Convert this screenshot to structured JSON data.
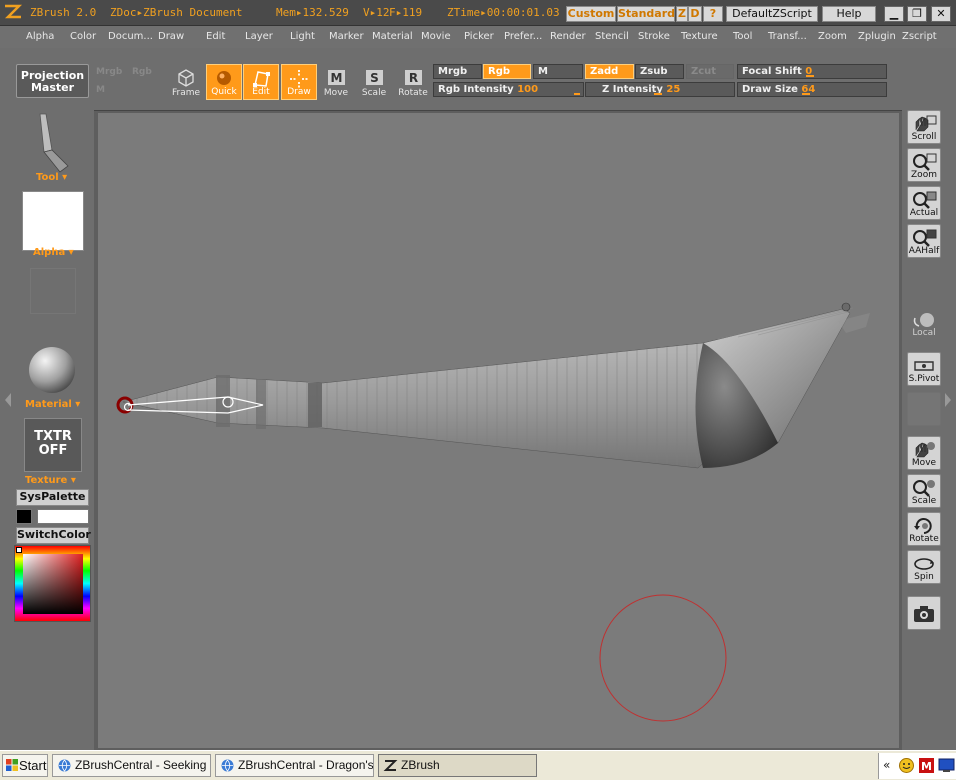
{
  "titlebar": {
    "app": "ZBrush 2.0",
    "doc": "ZDoc▸ZBrush Document",
    "mem": "Mem▸132.529",
    "vcount": "V▸12",
    "fcount": "F▸119",
    "ztime": "ZTime▸00:00:01.03",
    "custom": "Custom",
    "standard": "Standard",
    "z": "Z",
    "d": "D",
    "help_q": "?",
    "default_script": "DefaultZScript",
    "help": "Help",
    "win_min": "▁",
    "win_restore": "❐",
    "win_close": "✕"
  },
  "menu": [
    "Alpha",
    "Color",
    "Docum...",
    "Draw",
    "Edit",
    "Layer",
    "Light",
    "Marker",
    "Material",
    "Movie",
    "Picker",
    "Prefer...",
    "Render",
    "Stencil",
    "Stroke",
    "Texture",
    "Tool",
    "Transf...",
    "Zoom",
    "Zplugin",
    "Zscript"
  ],
  "shelf": {
    "projection_master": [
      "Projection",
      "Master"
    ],
    "modes": [
      {
        "label": "Frame",
        "icon": "frame-cube-icon",
        "active": false
      },
      {
        "label": "Quick",
        "icon": "quick-sphere-icon",
        "active": true
      },
      {
        "label": "Edit",
        "icon": "edit-box-icon",
        "active": true
      },
      {
        "label": "Draw",
        "icon": "draw-cross-icon",
        "active": true
      },
      {
        "label": "Move",
        "icon": "move-m-icon",
        "active": false
      },
      {
        "label": "Scale",
        "icon": "scale-s-icon",
        "active": false
      },
      {
        "label": "Rotate",
        "icon": "rotate-r-icon",
        "active": false
      }
    ],
    "dim_small": [
      "Mrgb",
      "Rgb",
      "M"
    ],
    "mrgb": "Mrgb",
    "rgb": "Rgb",
    "m": "M",
    "zadd": "Zadd",
    "zsub": "Zsub",
    "zcut": "Zcut",
    "rgb_intensity_label": "Rgb  Intensity",
    "rgb_intensity_value": "100",
    "z_intensity_label": "Z  Intensity",
    "z_intensity_value": "25",
    "focal_shift_label": "Focal  Shift",
    "focal_shift_value": "0",
    "draw_size_label": "Draw  Size",
    "draw_size_value": "64"
  },
  "leftpanel": {
    "tool": "Tool",
    "alpha": "Alpha",
    "material": "Material",
    "texture_button": [
      "TXTR",
      "OFF"
    ],
    "texture": "Texture",
    "syspalette": "SysPalette",
    "switchcolor": "SwitchColor"
  },
  "rightpanel": [
    {
      "label": "Scroll",
      "icon": "scroll-hand-icon",
      "dim": false
    },
    {
      "label": "Zoom",
      "icon": "zoom-magnifier-icon",
      "dim": false
    },
    {
      "label": "Actual",
      "icon": "actual-size-icon",
      "dim": false
    },
    {
      "label": "AAHalf",
      "icon": "aahalf-icon",
      "dim": false
    },
    {
      "label": "Local",
      "icon": "local-sphere-icon",
      "dim": true
    },
    {
      "label": "S.Pivot",
      "icon": "spivot-icon",
      "dim": false
    },
    {
      "label": "Move",
      "icon": "move-hand-icon",
      "dim": false
    },
    {
      "label": "Scale",
      "icon": "scale-magnifier-icon",
      "dim": false
    },
    {
      "label": "Rotate",
      "icon": "rotate-arrows-icon",
      "dim": false
    },
    {
      "label": "Spin",
      "icon": "spin-icon",
      "dim": false
    },
    {
      "label": "",
      "icon": "camera-icon",
      "dim": false
    }
  ],
  "taskbar": {
    "start": "Start",
    "tasks": [
      "ZBrushCentral - Seeking ...",
      "ZBrushCentral - Dragon's ...",
      "ZBrush"
    ],
    "tray_chevron": "«"
  },
  "colors": {
    "accent": "#ff9a1a",
    "panel": "#6e6e6e",
    "canvas": "#7b7b7b",
    "brush_ring": "#c03030"
  }
}
